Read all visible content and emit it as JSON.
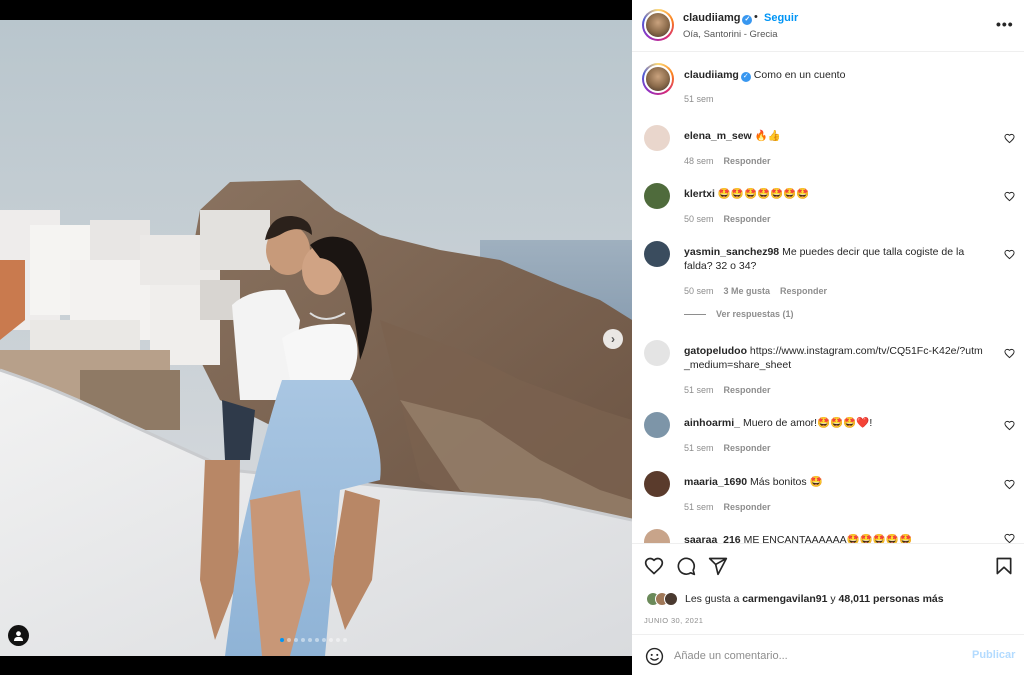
{
  "post": {
    "username": "claudiiamg",
    "follow_label": "Seguir",
    "separator": "•",
    "location": "Oía, Santorini - Grecia",
    "more_label": "•••",
    "next_label": "›",
    "carousel": {
      "count": 10,
      "active_index": 0
    }
  },
  "caption": {
    "username": "claudiiamg",
    "text": "Como en un cuento",
    "time": "51 sem"
  },
  "comments": [
    {
      "username": "elena_m_sew",
      "text": "🔥👍",
      "time": "48 sem",
      "likes": "",
      "reply": "Responder"
    },
    {
      "username": "klertxi",
      "text": "🤩🤩🤩🤩🤩🤩🤩",
      "time": "50 sem",
      "likes": "",
      "reply": "Responder"
    },
    {
      "username": "yasmin_sanchez98",
      "text": "Me puedes decir que talla cogiste de la falda? 32 o 34?",
      "time": "50 sem",
      "likes": "3 Me gusta",
      "reply": "Responder"
    },
    {
      "username": "gatopeludoo",
      "text": "https://www.instagram.com/tv/CQ51Fc-K42e/?utm_medium=share_sheet",
      "time": "51 sem",
      "likes": "",
      "reply": "Responder"
    },
    {
      "username": "ainhoarmi_",
      "text": "Muero de amor!🤩🤩🤩❤️!",
      "time": "51 sem",
      "likes": "",
      "reply": "Responder"
    },
    {
      "username": "maaria_1690",
      "text": "Más bonitos 🤩",
      "time": "51 sem",
      "likes": "",
      "reply": "Responder"
    },
    {
      "username": "saaraa_216",
      "text": "ME ENCANTAAAAAA🤩🤩🤩🤩🤩",
      "time": "",
      "likes": "",
      "reply": ""
    }
  ],
  "view_replies": "Ver respuestas (1)",
  "likes": {
    "prefix": "Les gusta a",
    "user": "carmengavilan91",
    "middle": "y",
    "count": "48,011 personas más"
  },
  "date": "JUNIO 30, 2021",
  "composer": {
    "placeholder": "Añade un comentario...",
    "publish_label": "Publicar"
  },
  "colors": {
    "accent": "#0095f6",
    "verified": "#3897f0",
    "publish_disabled": "#b3dbff",
    "muted": "#8e8e8e"
  },
  "icons": [
    "heart-icon",
    "comment-icon",
    "share-icon",
    "bookmark-icon",
    "emoji-icon",
    "user-tag-icon",
    "verified-icon",
    "more-icon"
  ]
}
